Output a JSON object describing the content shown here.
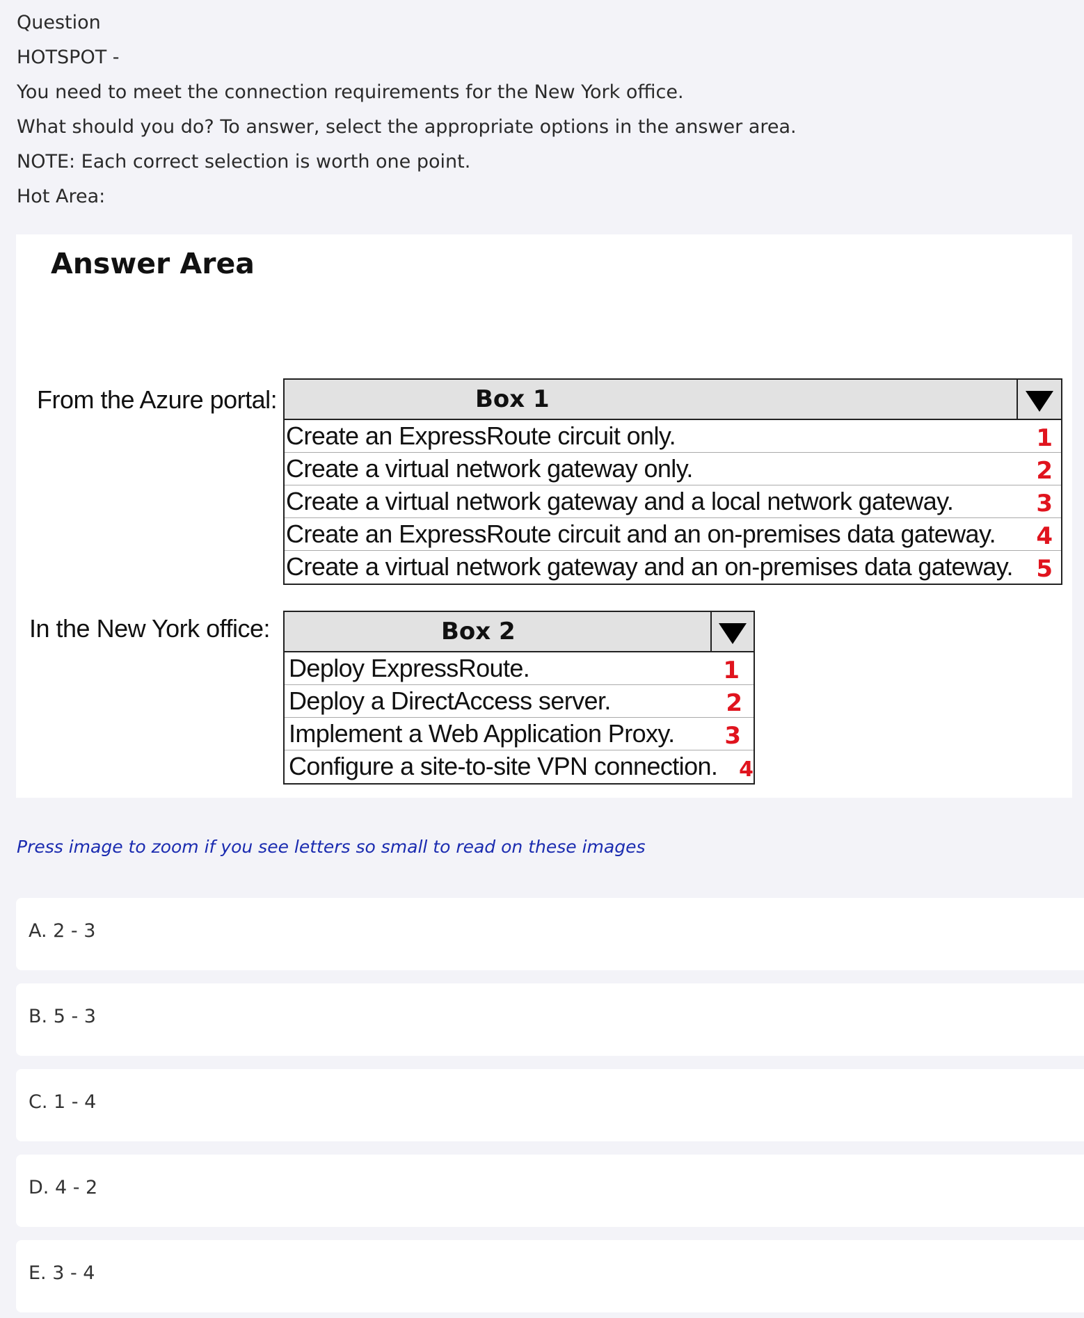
{
  "question": {
    "lines": [
      "Question",
      "HOTSPOT -",
      "You need to meet the connection requirements for the New York office.",
      "What should you do? To answer, select the appropriate options in the answer area.",
      "NOTE: Each correct selection is worth one point.",
      "Hot Area:"
    ]
  },
  "answer_area": {
    "title": "Answer Area",
    "box1": {
      "row_label": "From the Azure portal:",
      "header": "Box 1",
      "options": [
        {
          "text": "Create an ExpressRoute circuit only.",
          "num": "1"
        },
        {
          "text": "Create a virtual network gateway only.",
          "num": "2"
        },
        {
          "text": "Create a virtual network gateway and a local network gateway.",
          "num": "3"
        },
        {
          "text": "Create an ExpressRoute circuit and an on-premises data gateway.",
          "num": "4"
        },
        {
          "text": "Create a virtual network gateway and an on-premises data gateway.",
          "num": "5"
        }
      ]
    },
    "box2": {
      "row_label": "In the New York office:",
      "header": "Box 2",
      "options": [
        {
          "text": "Deploy ExpressRoute.",
          "num": "1"
        },
        {
          "text": "Deploy a DirectAccess server.",
          "num": "2"
        },
        {
          "text": "Implement a Web Application Proxy.",
          "num": "3"
        },
        {
          "text": "Configure a site-to-site VPN connection.",
          "num": "4"
        }
      ]
    }
  },
  "zoom_hint": "Press image to zoom if you see letters so small to read on these images",
  "choices": [
    {
      "label": "A. 2 - 3"
    },
    {
      "label": "B. 5 - 3"
    },
    {
      "label": "C. 1 - 4"
    },
    {
      "label": "D. 4 - 2"
    },
    {
      "label": "E. 3 - 4"
    }
  ],
  "colors": {
    "page_bg": "#f3f3f8",
    "panel_bg": "#ffffff",
    "option_number": "#e0141e",
    "hint_text": "#1a2bb0",
    "dropdown_header": "#e2e2e2"
  }
}
